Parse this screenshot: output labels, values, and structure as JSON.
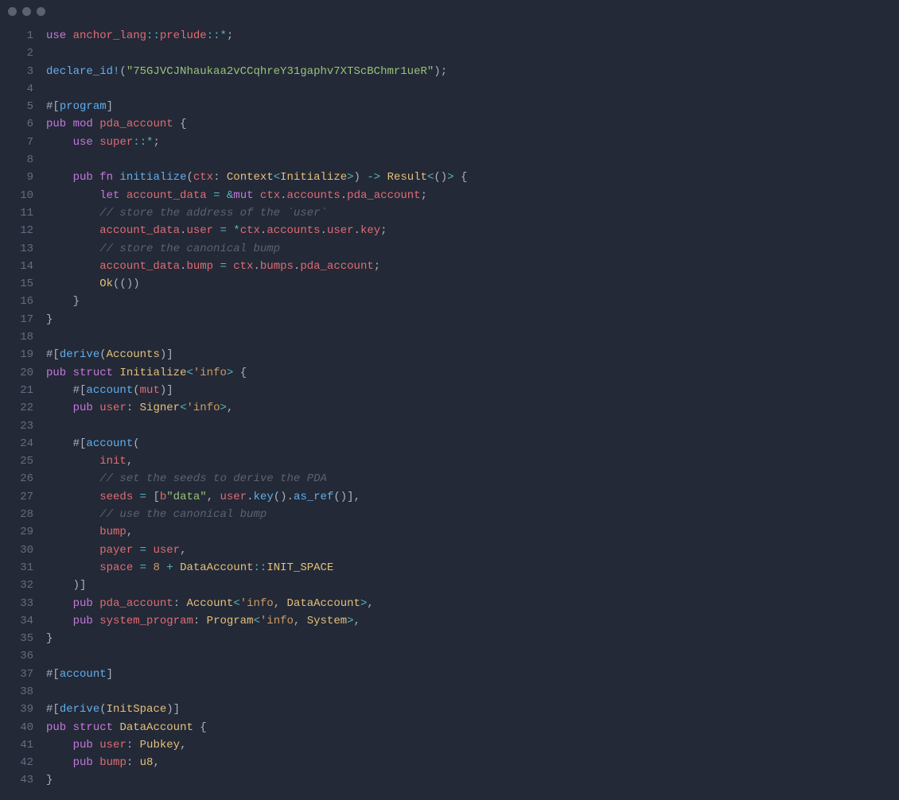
{
  "window_controls": [
    "close-dot",
    "min-dot",
    "max-dot"
  ],
  "line_count": 43,
  "code_lines": {
    "l1": [
      [
        "kw",
        "use"
      ],
      [
        "pn",
        " "
      ],
      [
        "id",
        "anchor_lang"
      ],
      [
        "op",
        "::"
      ],
      [
        "id",
        "prelude"
      ],
      [
        "op",
        "::*"
      ],
      [
        "pn",
        ";"
      ]
    ],
    "l2": [
      [
        "pn",
        ""
      ]
    ],
    "l3": [
      [
        "fnm",
        "declare_id!"
      ],
      [
        "pn",
        "("
      ],
      [
        "st",
        "\"75GJVCJNhaukaa2vCCqhreY31gaphv7XTScBChmr1ueR\""
      ],
      [
        "pn",
        ");"
      ]
    ],
    "l4": [
      [
        "pn",
        ""
      ]
    ],
    "l5": [
      [
        "at",
        "#["
      ],
      [
        "fnm",
        "program"
      ],
      [
        "at",
        "]"
      ]
    ],
    "l6": [
      [
        "kw",
        "pub"
      ],
      [
        "pn",
        " "
      ],
      [
        "kw",
        "mod"
      ],
      [
        "pn",
        " "
      ],
      [
        "id",
        "pda_account"
      ],
      [
        "pn",
        " {"
      ]
    ],
    "l7": [
      [
        "pn",
        "    "
      ],
      [
        "kw",
        "use"
      ],
      [
        "pn",
        " "
      ],
      [
        "id",
        "super"
      ],
      [
        "op",
        "::*"
      ],
      [
        "pn",
        ";"
      ]
    ],
    "l8": [
      [
        "pn",
        ""
      ]
    ],
    "l9": [
      [
        "pn",
        "    "
      ],
      [
        "kw",
        "pub"
      ],
      [
        "pn",
        " "
      ],
      [
        "kw",
        "fn"
      ],
      [
        "pn",
        " "
      ],
      [
        "fnm",
        "initialize"
      ],
      [
        "pn",
        "("
      ],
      [
        "id",
        "ctx"
      ],
      [
        "pn",
        ": "
      ],
      [
        "ty",
        "Context"
      ],
      [
        "op",
        "<"
      ],
      [
        "ty",
        "Initialize"
      ],
      [
        "op",
        ">"
      ],
      [
        "pn",
        ") "
      ],
      [
        "op",
        "->"
      ],
      [
        "pn",
        " "
      ],
      [
        "ty",
        "Result"
      ],
      [
        "op",
        "<"
      ],
      [
        "pn",
        "()"
      ],
      [
        "op",
        ">"
      ],
      [
        "pn",
        " {"
      ]
    ],
    "l10": [
      [
        "pn",
        "        "
      ],
      [
        "kw",
        "let"
      ],
      [
        "pn",
        " "
      ],
      [
        "id",
        "account_data"
      ],
      [
        "pn",
        " "
      ],
      [
        "op",
        "="
      ],
      [
        "pn",
        " "
      ],
      [
        "op",
        "&"
      ],
      [
        "kw",
        "mut"
      ],
      [
        "pn",
        " "
      ],
      [
        "id",
        "ctx"
      ],
      [
        "pn",
        "."
      ],
      [
        "id",
        "accounts"
      ],
      [
        "pn",
        "."
      ],
      [
        "id",
        "pda_account"
      ],
      [
        "pn",
        ";"
      ]
    ],
    "l11": [
      [
        "pn",
        "        "
      ],
      [
        "cm",
        "// store the address of the `user`"
      ]
    ],
    "l12": [
      [
        "pn",
        "        "
      ],
      [
        "id",
        "account_data"
      ],
      [
        "pn",
        "."
      ],
      [
        "id",
        "user"
      ],
      [
        "pn",
        " "
      ],
      [
        "op",
        "="
      ],
      [
        "pn",
        " "
      ],
      [
        "op",
        "*"
      ],
      [
        "id",
        "ctx"
      ],
      [
        "pn",
        "."
      ],
      [
        "id",
        "accounts"
      ],
      [
        "pn",
        "."
      ],
      [
        "id",
        "user"
      ],
      [
        "pn",
        "."
      ],
      [
        "id",
        "key"
      ],
      [
        "pn",
        ";"
      ]
    ],
    "l13": [
      [
        "pn",
        "        "
      ],
      [
        "cm",
        "// store the canonical bump"
      ]
    ],
    "l14": [
      [
        "pn",
        "        "
      ],
      [
        "id",
        "account_data"
      ],
      [
        "pn",
        "."
      ],
      [
        "id",
        "bump"
      ],
      [
        "pn",
        " "
      ],
      [
        "op",
        "="
      ],
      [
        "pn",
        " "
      ],
      [
        "id",
        "ctx"
      ],
      [
        "pn",
        "."
      ],
      [
        "id",
        "bumps"
      ],
      [
        "pn",
        "."
      ],
      [
        "id",
        "pda_account"
      ],
      [
        "pn",
        ";"
      ]
    ],
    "l15": [
      [
        "pn",
        "        "
      ],
      [
        "ty",
        "Ok"
      ],
      [
        "pn",
        "(())"
      ]
    ],
    "l16": [
      [
        "pn",
        "    }"
      ]
    ],
    "l17": [
      [
        "pn",
        "}"
      ]
    ],
    "l18": [
      [
        "pn",
        ""
      ]
    ],
    "l19": [
      [
        "at",
        "#["
      ],
      [
        "fnm",
        "derive"
      ],
      [
        "pn",
        "("
      ],
      [
        "ty",
        "Accounts"
      ],
      [
        "pn",
        ")"
      ],
      [
        "at",
        "]"
      ]
    ],
    "l20": [
      [
        "kw",
        "pub"
      ],
      [
        "pn",
        " "
      ],
      [
        "kw",
        "struct"
      ],
      [
        "pn",
        " "
      ],
      [
        "ty",
        "Initialize"
      ],
      [
        "op",
        "<"
      ],
      [
        "nm",
        "'info"
      ],
      [
        "op",
        ">"
      ],
      [
        "pn",
        " {"
      ]
    ],
    "l21": [
      [
        "pn",
        "    "
      ],
      [
        "at",
        "#["
      ],
      [
        "fnm",
        "account"
      ],
      [
        "pn",
        "("
      ],
      [
        "id",
        "mut"
      ],
      [
        "pn",
        ")"
      ],
      [
        "at",
        "]"
      ]
    ],
    "l22": [
      [
        "pn",
        "    "
      ],
      [
        "kw",
        "pub"
      ],
      [
        "pn",
        " "
      ],
      [
        "id",
        "user"
      ],
      [
        "pn",
        ": "
      ],
      [
        "ty",
        "Signer"
      ],
      [
        "op",
        "<"
      ],
      [
        "nm",
        "'info"
      ],
      [
        "op",
        ">"
      ],
      [
        "pn",
        ","
      ]
    ],
    "l23": [
      [
        "pn",
        ""
      ]
    ],
    "l24": [
      [
        "pn",
        "    "
      ],
      [
        "at",
        "#["
      ],
      [
        "fnm",
        "account"
      ],
      [
        "pn",
        "("
      ]
    ],
    "l25": [
      [
        "pn",
        "        "
      ],
      [
        "id",
        "init"
      ],
      [
        "pn",
        ","
      ]
    ],
    "l26": [
      [
        "pn",
        "        "
      ],
      [
        "cm",
        "// set the seeds to derive the PDA"
      ]
    ],
    "l27": [
      [
        "pn",
        "        "
      ],
      [
        "id",
        "seeds"
      ],
      [
        "pn",
        " "
      ],
      [
        "op",
        "="
      ],
      [
        "pn",
        " ["
      ],
      [
        "id",
        "b"
      ],
      [
        "st",
        "\"data\""
      ],
      [
        "pn",
        ", "
      ],
      [
        "id",
        "user"
      ],
      [
        "pn",
        "."
      ],
      [
        "fnm",
        "key"
      ],
      [
        "pn",
        "()."
      ],
      [
        "fnm",
        "as_ref"
      ],
      [
        "pn",
        "()],"
      ]
    ],
    "l28": [
      [
        "pn",
        "        "
      ],
      [
        "cm",
        "// use the canonical bump"
      ]
    ],
    "l29": [
      [
        "pn",
        "        "
      ],
      [
        "id",
        "bump"
      ],
      [
        "pn",
        ","
      ]
    ],
    "l30": [
      [
        "pn",
        "        "
      ],
      [
        "id",
        "payer"
      ],
      [
        "pn",
        " "
      ],
      [
        "op",
        "="
      ],
      [
        "pn",
        " "
      ],
      [
        "id",
        "user"
      ],
      [
        "pn",
        ","
      ]
    ],
    "l31": [
      [
        "pn",
        "        "
      ],
      [
        "id",
        "space"
      ],
      [
        "pn",
        " "
      ],
      [
        "op",
        "="
      ],
      [
        "pn",
        " "
      ],
      [
        "nm",
        "8"
      ],
      [
        "pn",
        " "
      ],
      [
        "op",
        "+"
      ],
      [
        "pn",
        " "
      ],
      [
        "ty",
        "DataAccount"
      ],
      [
        "op",
        "::"
      ],
      [
        "ty",
        "INIT_SPACE"
      ]
    ],
    "l32": [
      [
        "pn",
        "    )"
      ],
      [
        "at",
        "]"
      ]
    ],
    "l33": [
      [
        "pn",
        "    "
      ],
      [
        "kw",
        "pub"
      ],
      [
        "pn",
        " "
      ],
      [
        "id",
        "pda_account"
      ],
      [
        "pn",
        ": "
      ],
      [
        "ty",
        "Account"
      ],
      [
        "op",
        "<"
      ],
      [
        "nm",
        "'info"
      ],
      [
        "pn",
        ", "
      ],
      [
        "ty",
        "DataAccount"
      ],
      [
        "op",
        ">"
      ],
      [
        "pn",
        ","
      ]
    ],
    "l34": [
      [
        "pn",
        "    "
      ],
      [
        "kw",
        "pub"
      ],
      [
        "pn",
        " "
      ],
      [
        "id",
        "system_program"
      ],
      [
        "pn",
        ": "
      ],
      [
        "ty",
        "Program"
      ],
      [
        "op",
        "<"
      ],
      [
        "nm",
        "'info"
      ],
      [
        "pn",
        ", "
      ],
      [
        "ty",
        "System"
      ],
      [
        "op",
        ">"
      ],
      [
        "pn",
        ","
      ]
    ],
    "l35": [
      [
        "pn",
        "}"
      ]
    ],
    "l36": [
      [
        "pn",
        ""
      ]
    ],
    "l37": [
      [
        "at",
        "#["
      ],
      [
        "fnm",
        "account"
      ],
      [
        "at",
        "]"
      ]
    ],
    "l38": [
      [
        "pn",
        ""
      ]
    ],
    "l39": [
      [
        "at",
        "#["
      ],
      [
        "fnm",
        "derive"
      ],
      [
        "pn",
        "("
      ],
      [
        "ty",
        "InitSpace"
      ],
      [
        "pn",
        ")"
      ],
      [
        "at",
        "]"
      ]
    ],
    "l40": [
      [
        "kw",
        "pub"
      ],
      [
        "pn",
        " "
      ],
      [
        "kw",
        "struct"
      ],
      [
        "pn",
        " "
      ],
      [
        "ty",
        "DataAccount"
      ],
      [
        "pn",
        " {"
      ]
    ],
    "l41": [
      [
        "pn",
        "    "
      ],
      [
        "kw",
        "pub"
      ],
      [
        "pn",
        " "
      ],
      [
        "id",
        "user"
      ],
      [
        "pn",
        ": "
      ],
      [
        "ty",
        "Pubkey"
      ],
      [
        "pn",
        ","
      ]
    ],
    "l42": [
      [
        "pn",
        "    "
      ],
      [
        "kw",
        "pub"
      ],
      [
        "pn",
        " "
      ],
      [
        "id",
        "bump"
      ],
      [
        "pn",
        ": "
      ],
      [
        "ty",
        "u8"
      ],
      [
        "pn",
        ","
      ]
    ],
    "l43": [
      [
        "pn",
        "}"
      ]
    ]
  }
}
